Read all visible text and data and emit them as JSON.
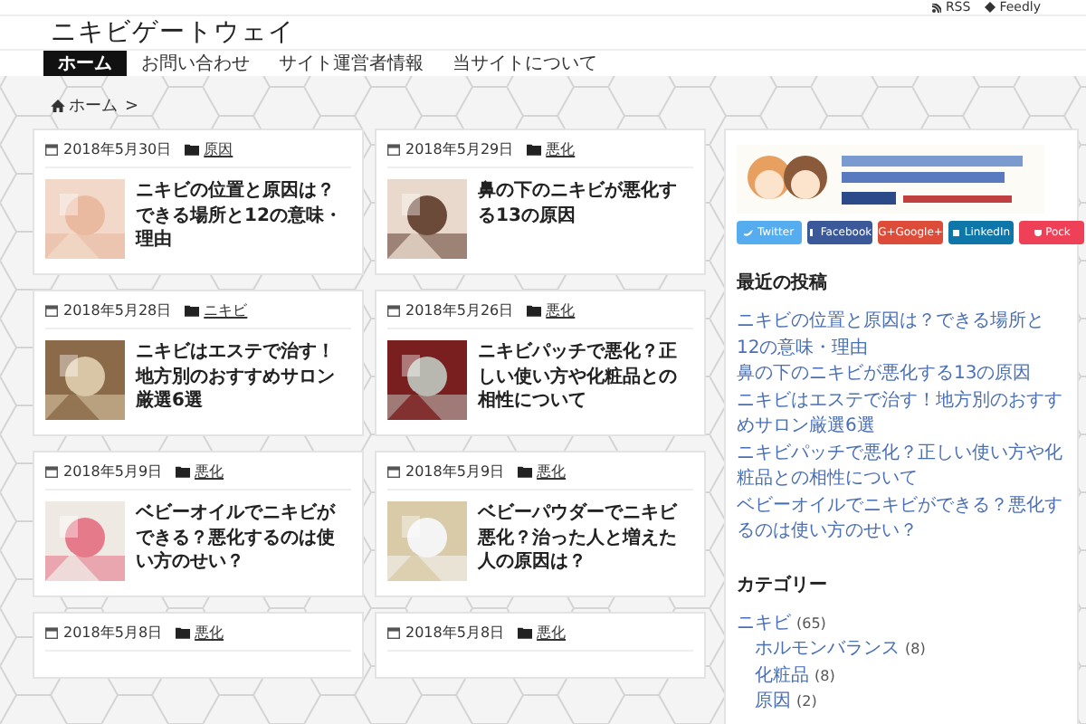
{
  "top_links": [
    {
      "kind": "rss",
      "label": "RSS"
    },
    {
      "kind": "feedly",
      "label": "Feedly"
    }
  ],
  "site_title": "ニキビゲートウェイ",
  "nav": [
    {
      "label": "ホーム",
      "selected": true
    },
    {
      "label": "お問い合わせ",
      "selected": false
    },
    {
      "label": "サイト運営者情報",
      "selected": false
    },
    {
      "label": "当サイトについて",
      "selected": false
    }
  ],
  "breadcrumb": {
    "home": "ホーム",
    "separator": ">"
  },
  "posts": [
    {
      "date": "2018年5月30日",
      "category": "原因",
      "title": "ニキビの位置と原因は？できる場所と12の意味・理由"
    },
    {
      "date": "2018年5月29日",
      "category": "悪化",
      "title": "鼻の下のニキビが悪化する13の原因"
    },
    {
      "date": "2018年5月28日",
      "category": "ニキビ",
      "title": "ニキビはエステで治す！地方別のおすすめサロン厳選6選"
    },
    {
      "date": "2018年5月26日",
      "category": "悪化",
      "title": "ニキビパッチで悪化？正しい使い方や化粧品との相性について"
    },
    {
      "date": "2018年5月9日",
      "category": "悪化",
      "title": "ベビーオイルでニキビができる？悪化するのは使い方のせい？"
    },
    {
      "date": "2018年5月9日",
      "category": "悪化",
      "title": "ベビーパウダーでニキビ悪化？治った人と増えた人の原因は？"
    },
    {
      "date": "2018年5月8日",
      "category": "悪化"
    },
    {
      "date": "2018年5月8日",
      "category": "悪化"
    }
  ],
  "sidebar": {
    "share_buttons": [
      {
        "kind": "twitter",
        "label": "Twitter",
        "color": "#55acee"
      },
      {
        "kind": "facebook",
        "label": "Facebook",
        "color": "#3b5998"
      },
      {
        "kind": "google",
        "label": "G+Google+",
        "color": "#dd4b39"
      },
      {
        "kind": "linkedin",
        "label": "LinkedIn",
        "color": "#0e76a8"
      },
      {
        "kind": "pocket",
        "label": "Pock",
        "color": "#ee4056"
      }
    ],
    "recent": {
      "heading": "最近の投稿",
      "items": [
        "ニキビの位置と原因は？できる場所と12の意味・理由",
        "鼻の下のニキビが悪化する13の原因",
        "ニキビはエステで治す！地方別のおすすめサロン厳選6選",
        "ニキビパッチで悪化？正しい使い方や化粧品との相性について",
        "ベビーオイルでニキビができる？悪化するのは使い方のせい？"
      ]
    },
    "categories": {
      "heading": "カテゴリー",
      "items": [
        {
          "name": "ニキビ",
          "count": "(65)",
          "children": [
            {
              "name": "ホルモンバランス",
              "count": "(8)"
            },
            {
              "name": "化粧品",
              "count": "(8)"
            },
            {
              "name": "原因",
              "count": "(2)"
            }
          ]
        }
      ]
    }
  }
}
